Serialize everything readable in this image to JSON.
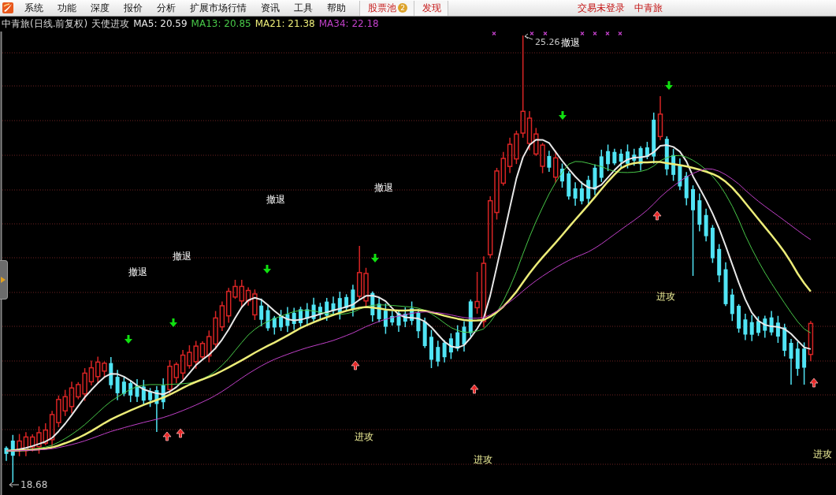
{
  "menu": {
    "items": [
      "系统",
      "功能",
      "深度",
      "报价",
      "分析",
      "扩展市场行情",
      "资讯",
      "工具",
      "帮助"
    ],
    "quick_buttons": [
      {
        "label": "股票池",
        "badge": "2"
      },
      {
        "label": "发现"
      }
    ],
    "trade_status": "交易未登录",
    "current_stock": "中青旅"
  },
  "chart": {
    "title": "中青旅(日线.前复权)",
    "indicator": "天使进攻",
    "legend": [
      {
        "text": "MA5: 20.59",
        "color": "#e8e8e8"
      },
      {
        "text": "MA13: 20.85",
        "color": "#48c848"
      },
      {
        "text": "MA21: 21.38",
        "color": "#ecec78"
      },
      {
        "text": "MA34: 22.18",
        "color": "#c040c8"
      }
    ],
    "high_label": "25.26",
    "low_label": "18.68",
    "signals": [
      {
        "kind": "retreat",
        "text": "撤退"
      },
      {
        "kind": "retreat",
        "text": "撤退"
      },
      {
        "kind": "retreat",
        "text": "撤退"
      },
      {
        "kind": "attack",
        "text": "进攻"
      },
      {
        "kind": "retreat",
        "text": "撤退"
      },
      {
        "kind": "attack",
        "text": "进攻"
      },
      {
        "kind": "retreat",
        "text": "撤退"
      },
      {
        "kind": "attack",
        "text": "进攻"
      },
      {
        "kind": "attack",
        "text": "进攻"
      }
    ]
  }
}
